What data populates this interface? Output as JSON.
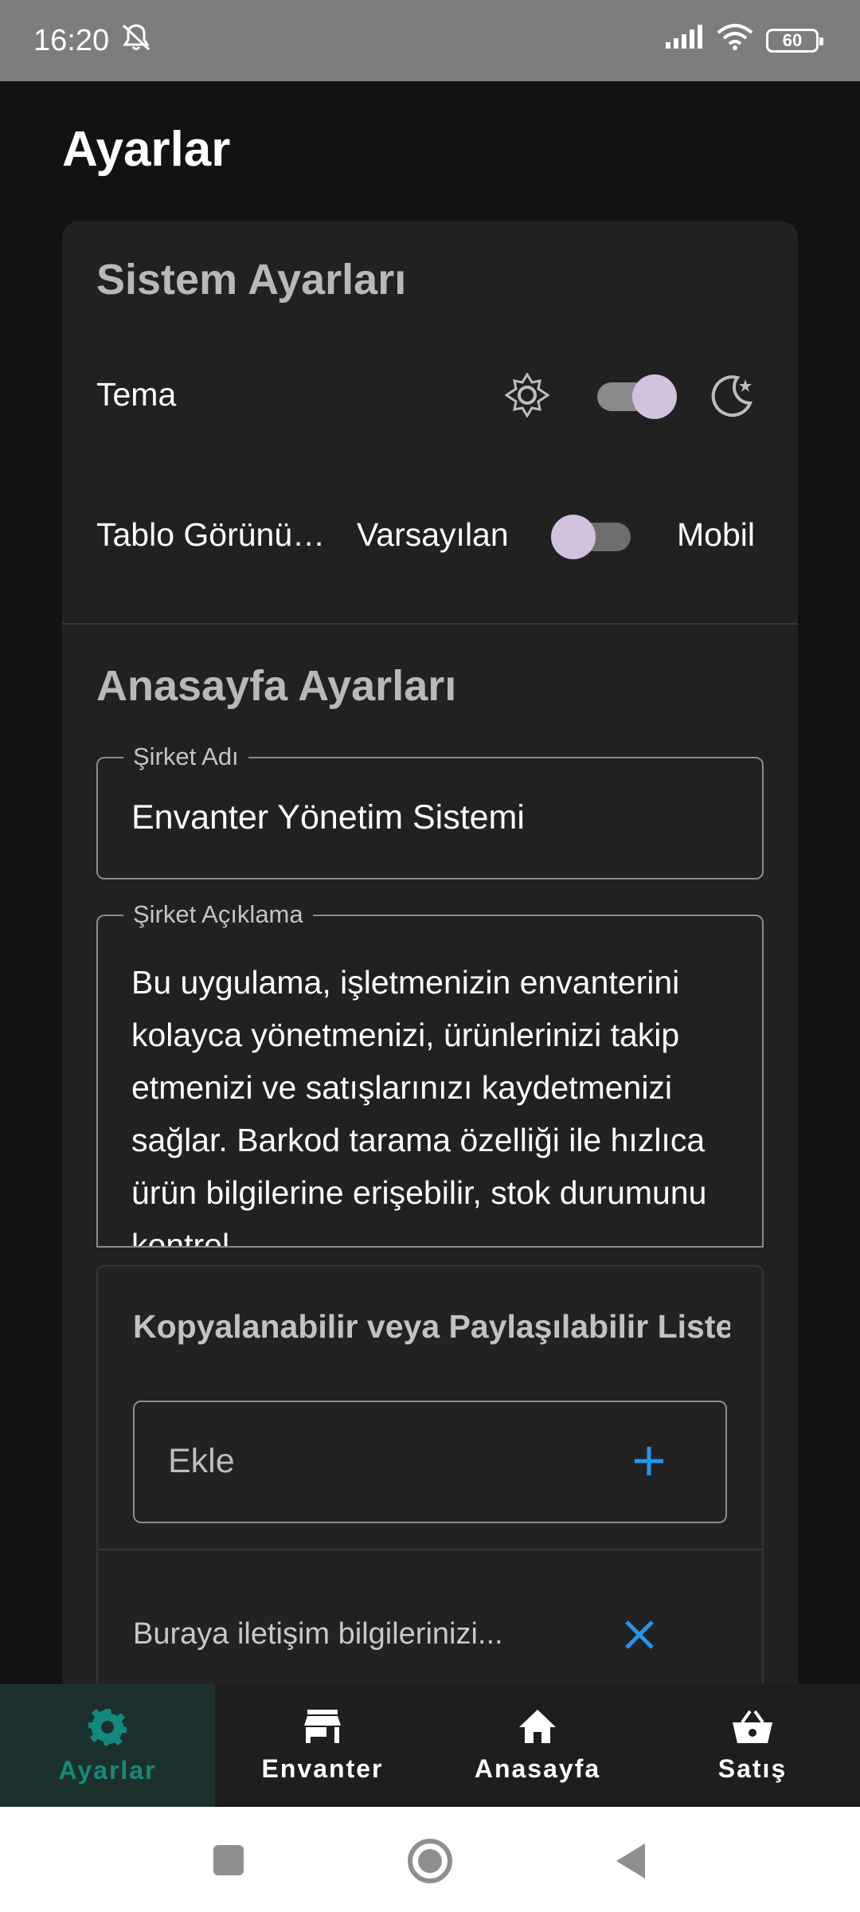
{
  "status_bar": {
    "time": "16:20",
    "battery": "60"
  },
  "page_title": "Ayarlar",
  "system_settings": {
    "title": "Sistem Ayarları",
    "theme_label": "Tema",
    "table_label": "Tablo Görünü…",
    "table_option_default": "Varsayılan",
    "table_option_mobile": "Mobil",
    "theme_dark_enabled": true,
    "table_mobile_enabled": false
  },
  "home_settings": {
    "title": "Anasayfa Ayarları",
    "company_name_label": "Şirket Adı",
    "company_name_value": "Envanter Yönetim Sistemi",
    "company_desc_label": "Şirket Açıklama",
    "company_desc_value": "Bu uygulama, işletmenizin envanterini kolayca yönetmenizi, ürünlerinizi takip etmenizi ve satışlarınızı kaydetmenizi sağlar. Barkod tarama özelliği ile hızlıca ürün bilgilerine erişebilir, stok durumunu kontrol",
    "list_title": "Kopyalanabilir veya Paylaşılabilir Liste",
    "add_placeholder": "Ekle",
    "list_items": [
      {
        "text": "Buraya iletişim bilgilerinizi..."
      }
    ]
  },
  "bottom_nav": [
    {
      "label": "Ayarlar",
      "icon": "gear-icon",
      "active": true
    },
    {
      "label": "Envanter",
      "icon": "store-icon",
      "active": false
    },
    {
      "label": "Anasayfa",
      "icon": "home-icon",
      "active": false
    },
    {
      "label": "Satış",
      "icon": "basket-icon",
      "active": false
    }
  ],
  "colors": {
    "accent": "#14897b",
    "switch_thumb": "#d3c2de",
    "icon_blue": "#2196f3"
  }
}
